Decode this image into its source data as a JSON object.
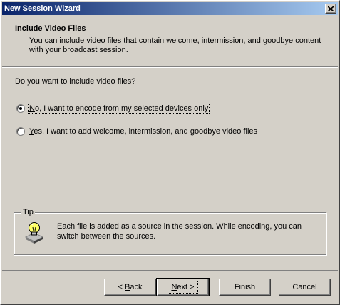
{
  "window": {
    "title": "New Session Wizard"
  },
  "header": {
    "title": "Include Video Files",
    "description": "You can include video files that contain welcome, intermission, and goodbye content with your broadcast session."
  },
  "question": "Do you want to include video files?",
  "options": [
    {
      "access_key": "N",
      "rest": "o, I want to encode from my selected devices only",
      "selected": true
    },
    {
      "access_key": "Y",
      "rest": "es, I want to add welcome, intermission, and goodbye video files",
      "selected": false
    }
  ],
  "tip": {
    "legend": "Tip",
    "icon": "lightbulb-icon",
    "text": "Each file is added as a source in the session. While encoding, you can switch between the sources."
  },
  "buttons": {
    "back": {
      "prefix": "< ",
      "access_key": "B",
      "rest": "ack"
    },
    "next": {
      "access_key": "N",
      "rest": "ext >"
    },
    "finish": "Finish",
    "cancel": "Cancel"
  },
  "colors": {
    "title_start": "#0a246a",
    "title_end": "#a6caf0",
    "face": "#d4d0c8"
  }
}
